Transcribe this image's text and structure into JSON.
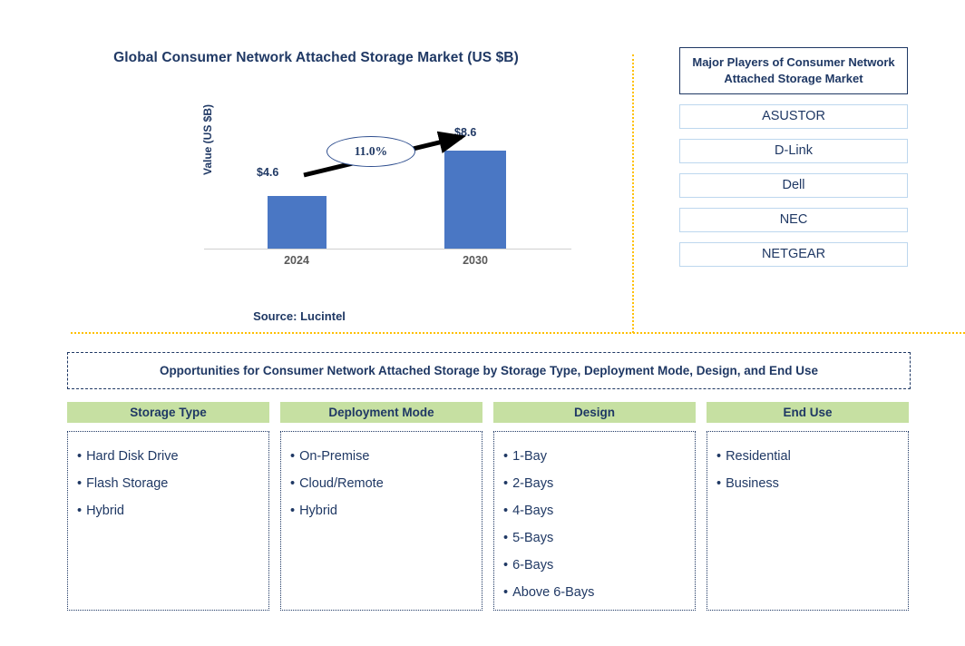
{
  "chart_panel": {
    "title": "Global Consumer Network Attached Storage Market (US $B)",
    "source": "Source: Lucintel"
  },
  "chart_data": {
    "type": "bar",
    "title": "Global Consumer Network Attached Storage Market (US $B)",
    "xlabel": "",
    "ylabel": "Value (US $B)",
    "categories": [
      "2024",
      "2030"
    ],
    "values": [
      4.6,
      8.6
    ],
    "value_labels": [
      "$4.6",
      "$8.6"
    ],
    "annotation": "11.0%",
    "annotation_type": "CAGR",
    "ylim": [
      0,
      10
    ],
    "grid": false,
    "legend": "none",
    "bar_color": "#4A77C4"
  },
  "players": {
    "header": "Major Players of Consumer Network Attached Storage Market",
    "items": [
      "ASUSTOR",
      "D-Link",
      "Dell",
      "NEC",
      "NETGEAR"
    ]
  },
  "opportunities": {
    "title": "Opportunities for Consumer Network Attached Storage by Storage Type, Deployment Mode, Design, and End Use",
    "columns": [
      {
        "header": "Storage Type",
        "items": [
          "Hard Disk Drive",
          "Flash Storage",
          "Hybrid"
        ]
      },
      {
        "header": "Deployment Mode",
        "items": [
          "On-Premise",
          "Cloud/Remote",
          "Hybrid"
        ]
      },
      {
        "header": "Design",
        "items": [
          "1-Bay",
          "2-Bays",
          "4-Bays",
          "5-Bays",
          "6-Bays",
          "Above 6-Bays"
        ]
      },
      {
        "header": "End Use",
        "items": [
          "Residential",
          "Business"
        ]
      }
    ]
  },
  "colors": {
    "navy": "#1F3864",
    "bar_blue": "#4A77C4",
    "header_green": "#C6E0A2",
    "divider_orange": "#FFC000",
    "row_border_blue": "#BDD7EE"
  },
  "icons": {
    "bullet": "•",
    "growth_arrow": "growth-arrow-icon"
  }
}
